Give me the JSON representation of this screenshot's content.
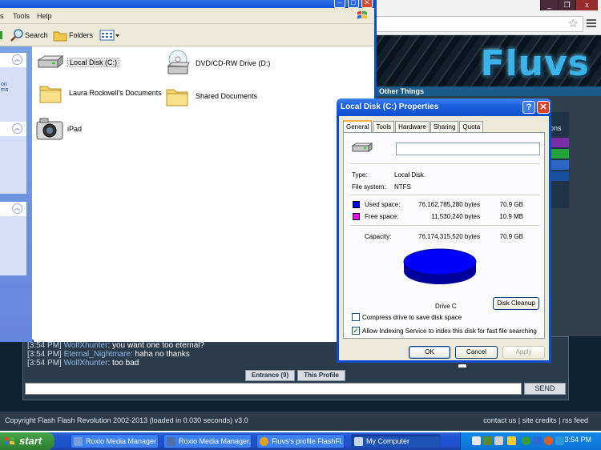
{
  "browser": {
    "controls": [
      "_",
      "❐",
      "x"
    ],
    "logo_text": "Fluvs",
    "other_things": "Other Things",
    "side_label": "ons",
    "swatch_colors": [
      "#7b2fa5",
      "#22a33a",
      "#2b66c8",
      "#1a4f9e"
    ]
  },
  "chat": {
    "messages": [
      {
        "time": "[3:54 PM]",
        "name": "WolfXhunter",
        "text": "you want one too eternal?"
      },
      {
        "time": "[3:54 PM]",
        "name": "Eternal_Nightmare",
        "text": "haha no thanks"
      },
      {
        "time": "[3:54 PM]",
        "name": "WolfXhunter",
        "text": "too bad"
      }
    ],
    "entrance_label": "Entrance (9)",
    "this_profile_label": "This Profile",
    "send_label": "SEND"
  },
  "footer": {
    "left": "Copyright Flash Flash Revolution 2002-2013 (loaded in 0.030 seconds) v3.0",
    "right": "contact us | site credits | rss feed"
  },
  "explorer": {
    "menu": [
      "s",
      "Tools",
      "Help"
    ],
    "toolbar": {
      "search": "Search",
      "folders": "Folders"
    },
    "sidebar_links": [
      "on",
      "ms"
    ],
    "items": {
      "local_disk": "Local Disk (C:)",
      "dvd": "DVD/CD-RW Drive (D:)",
      "laura_docs": "Laura Rockwell's Documents",
      "shared_docs": "Shared Documents",
      "ipad": "iPad"
    }
  },
  "props": {
    "title": "Local Disk (C:) Properties",
    "help": "?",
    "close": "✕",
    "tabs": [
      "General",
      "Tools",
      "Hardware",
      "Sharing",
      "Quota"
    ],
    "name_value": "",
    "type_label": "Type:",
    "type_value": "Local Disk",
    "fs_label": "File system:",
    "fs_value": "NTFS",
    "used_label": "Used space:",
    "used_bytes": "76,162,785,280 bytes",
    "used_gb": "70.9 GB",
    "free_label": "Free space:",
    "free_bytes": "11,530,240 bytes",
    "free_mb": "10.9 MB",
    "capacity_label": "Capacity:",
    "capacity_bytes": "76,174,315,520 bytes",
    "capacity_gb": "70.9 GB",
    "drive_label": "Drive C",
    "disk_cleanup": "Disk Cleanup",
    "compress_label": "Compress drive to save disk space",
    "compress_checked": false,
    "index_label": "Allow Indexing Service to index this disk for fast file searching",
    "index_checked": true,
    "ok": "OK",
    "cancel": "Cancel",
    "apply": "Apply",
    "colors": {
      "used": "#0000ff",
      "free": "#ff00ff"
    },
    "used_fraction": 0.99985
  },
  "taskbar": {
    "start": "start",
    "tasks": [
      {
        "label": "Roxio Media Manager",
        "color": "#7a9fd8"
      },
      {
        "label": "Roxio Media Manager...",
        "color": "#4f6fa8"
      },
      {
        "label": "Fluvs's profile FlashFl...",
        "color": "#e0a020"
      },
      {
        "label": "My Computer",
        "color": "#c6d7ef"
      }
    ],
    "clock": "3:54 PM",
    "tray_colors": [
      "#e8e8e8",
      "#5a8a2a",
      "#d0d0d0",
      "#ffcc33",
      "#3a9a3a",
      "#2a6ad8",
      "#e05a2a",
      "#2a9ad8"
    ]
  }
}
